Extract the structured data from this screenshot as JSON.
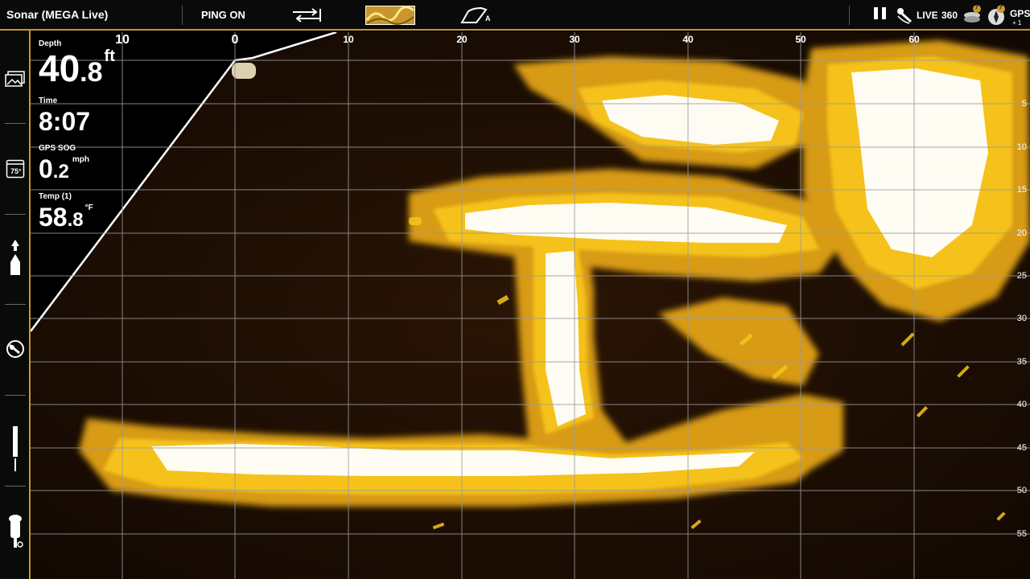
{
  "topbar": {
    "title": "Sonar (MEGA Live)",
    "ping": "PING ON",
    "mode_label": "A",
    "live": "LIVE",
    "s360": "360",
    "gps": "GPS",
    "badge_a": "?",
    "badge_b": "?",
    "gps_sub": "+ 1"
  },
  "readouts": {
    "depth": {
      "label": "Depth",
      "int": "40",
      "dec": ".8",
      "unit": "ft"
    },
    "time": {
      "label": "Time",
      "value": "8:07"
    },
    "sog": {
      "label": "GPS SOG",
      "int": "0",
      "dec": ".2",
      "unit": "mph"
    },
    "temp": {
      "label": "Temp (1)",
      "int": "58",
      "dec": ".8",
      "unit": "°F"
    }
  },
  "sidebar": {
    "water_temp_icon": "75°"
  },
  "x_axis": {
    "labels": [
      "10",
      "0",
      "10",
      "20",
      "30",
      "40",
      "50",
      "60"
    ]
  },
  "y_axis": {
    "labels": [
      "5",
      "10",
      "15",
      "20",
      "25",
      "30",
      "35",
      "40",
      "45",
      "50",
      "55"
    ]
  },
  "colors": {
    "accent": "#c8962a",
    "sonar_bright": "#ffffff",
    "sonar_mid": "#f5c518",
    "sonar_dark": "#1a0d05"
  }
}
